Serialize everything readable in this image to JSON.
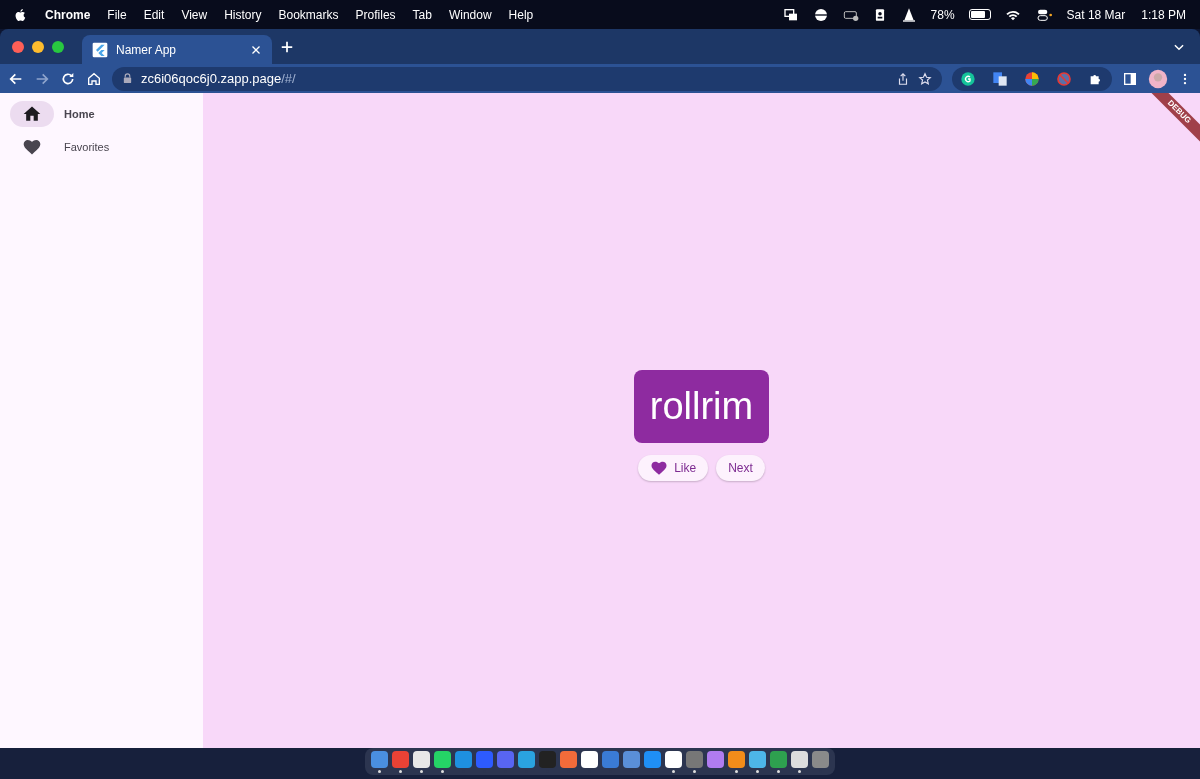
{
  "menu_bar": {
    "app_name": "Chrome",
    "items": [
      "File",
      "Edit",
      "View",
      "History",
      "Bookmarks",
      "Profiles",
      "Tab",
      "Window",
      "Help"
    ],
    "battery_percent": "78%",
    "battery": {
      "level": 0.78
    },
    "date": "Sat 18 Mar",
    "time": "1:18 PM"
  },
  "browser": {
    "tabs": [
      {
        "title": "Namer App",
        "selected": true
      }
    ],
    "url_host": "zc6i06qoc6j0.zapp.page",
    "url_path": "/#/"
  },
  "sidebar": {
    "items": [
      {
        "label": "Home",
        "kind": "home",
        "selected": true
      },
      {
        "label": "Favorites",
        "kind": "heart",
        "selected": false
      }
    ]
  },
  "main": {
    "word": "rollrim",
    "buttons": [
      {
        "label": "Like",
        "kind": "like"
      },
      {
        "label": "Next",
        "kind": "plain"
      }
    ],
    "banner": "DEBUG"
  },
  "dock": {
    "apps": [
      {
        "color": "#4a8fe0",
        "running": true
      },
      {
        "color": "#e94235",
        "running": true
      },
      {
        "color": "#e8e8e8",
        "running": true
      },
      {
        "color": "#25d366",
        "running": true
      },
      {
        "color": "#1e90e0",
        "running": false
      },
      {
        "color": "#2d5bff",
        "running": false
      },
      {
        "color": "#5865f2",
        "running": false
      },
      {
        "color": "#2aa3e0",
        "running": false
      },
      {
        "color": "#222222",
        "running": false
      },
      {
        "color": "#f26b3a",
        "running": false
      },
      {
        "color": "#ffffff",
        "running": false
      },
      {
        "color": "#3a7bd5",
        "running": false
      },
      {
        "color": "#5a8fd8",
        "running": false
      },
      {
        "color": "#1f8ff5",
        "running": false
      },
      {
        "color": "#ffffff",
        "running": true
      },
      {
        "color": "#777777",
        "running": true
      },
      {
        "color": "#b07cf0",
        "running": false
      },
      {
        "color": "#f28c1a",
        "running": true
      },
      {
        "color": "#4db6e8",
        "running": true
      },
      {
        "color": "#2ea04f",
        "running": true
      },
      {
        "color": "#dddddd",
        "running": true
      },
      {
        "color": "#8a8a8a",
        "running": false
      }
    ]
  }
}
